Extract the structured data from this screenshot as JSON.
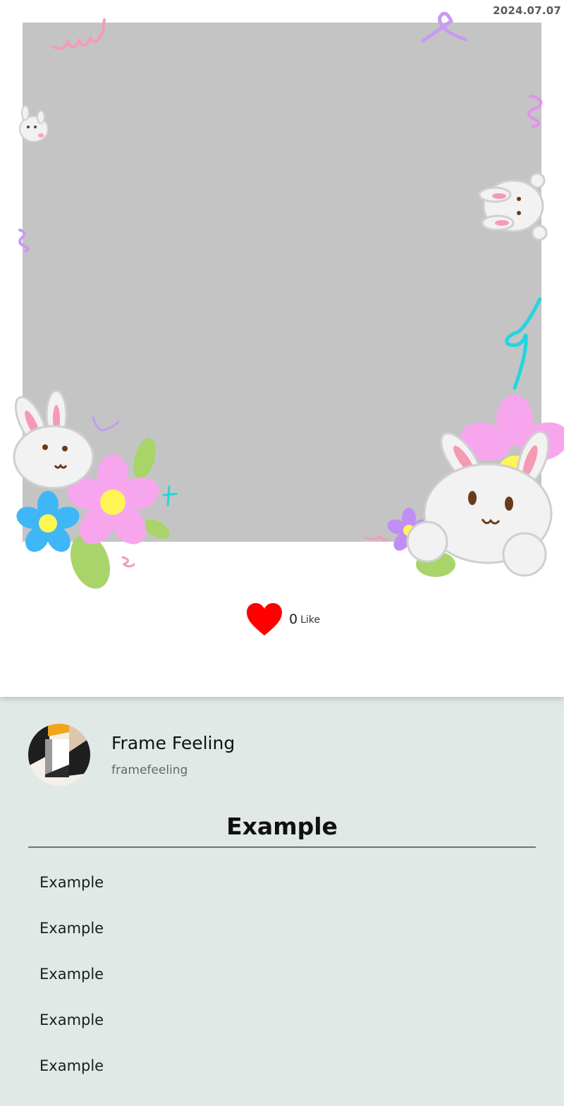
{
  "header": {
    "date": "2024.07.07"
  },
  "photo": {
    "background_color": "#c4c4c4"
  },
  "like": {
    "count": "0",
    "label": "Like",
    "heart_color": "#ff0000"
  },
  "profile": {
    "name": "Frame Feeling",
    "handle": "framefeeling"
  },
  "section": {
    "title": "Example",
    "items": [
      {
        "label": "Example"
      },
      {
        "label": "Example"
      },
      {
        "label": "Example"
      },
      {
        "label": "Example"
      },
      {
        "label": "Example"
      }
    ]
  },
  "colors": {
    "panel_background": "#e1e9e6",
    "card_background": "#ffffff"
  }
}
